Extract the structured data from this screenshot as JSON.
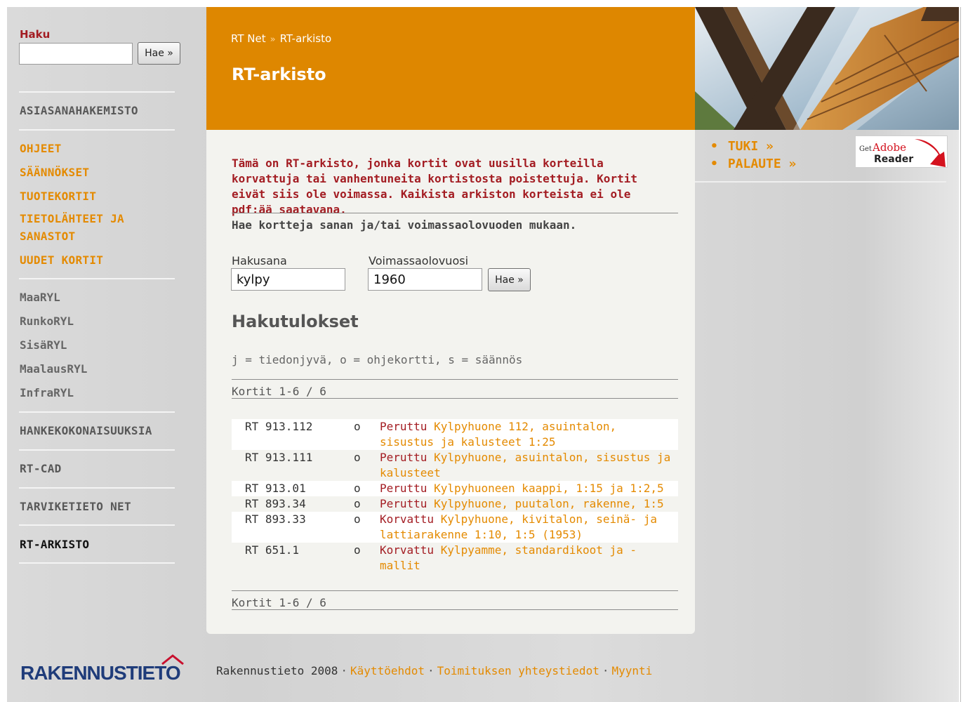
{
  "sidebar": {
    "search_label": "Haku",
    "search_button": "Hae »",
    "nav_top": "ASIASANAHAKEMISTO",
    "orange_items": [
      "OHJEET",
      "SÄÄNNÖKSET",
      "TUOTEKORTIT",
      "TIETOLÄHTEET JA",
      "SANASTOT",
      "UUDET KORTIT"
    ],
    "ryl_items": [
      "MaaRYL",
      "RunkoRYL",
      "SisäRYL",
      "MaalausRYL",
      "InfraRYL"
    ],
    "section_items": [
      "HANKEKOKONAISUUKSIA",
      "RT-CAD",
      "TARVIKETIETO NET",
      "RT-ARKISTO"
    ]
  },
  "header": {
    "breadcrumb": [
      "RT Net",
      "RT-arkisto"
    ],
    "breadcrumb_sep": "»",
    "title": "RT-arkisto"
  },
  "main": {
    "notice": "Tämä on RT-arkisto, jonka kortit ovat uusilla korteilla korvattuja tai vanhentuneita kortistosta poistettuja. Kortit eivät siis ole voimassa. Kaikista arkiston korteista ei ole pdf:ää saatavana.",
    "instructions": "Hae kortteja sanan ja/tai voimassaolovuoden mukaan.",
    "keyword_label": "Hakusana",
    "keyword_value": "kylpy",
    "year_label": "Voimassaolovuosi",
    "year_value": "1960",
    "search_button": "Hae »",
    "results_title": "Hakutulokset",
    "legend": "j = tiedonjyvä, o = ohjekortti, s = säännös",
    "count_top": "Kortit 1-6 / 6",
    "count_bottom": "Kortit 1-6 / 6",
    "results": [
      {
        "code": "RT 913.112",
        "type": "o",
        "status": "Peruttu",
        "title": "Kylpyhuone 112, asuintalon, sisustus ja kalusteet 1:25"
      },
      {
        "code": "RT 913.111",
        "type": "o",
        "status": "Peruttu",
        "title": "Kylpyhuone, asuintalon, sisustus ja kalusteet"
      },
      {
        "code": "RT 913.01",
        "type": "o",
        "status": "Peruttu",
        "title": "Kylpyhuoneen kaappi, 1:15 ja 1:2,5"
      },
      {
        "code": "RT 893.34",
        "type": "o",
        "status": "Peruttu",
        "title": "Kylpyhuone, puutalon, rakenne, 1:5"
      },
      {
        "code": "RT 893.33",
        "type": "o",
        "status": "Korvattu",
        "title": "Kylpyhuone, kivitalon, seinä- ja lattiarakenne 1:10, 1:5 (1953)"
      },
      {
        "code": "RT 651.1",
        "type": "o",
        "status": "Korvattu",
        "title": "Kylpyamme, standardikoot ja -mallit"
      }
    ]
  },
  "right": {
    "links": [
      "TUKI »",
      "PALAUTE »"
    ],
    "adobe_get": "Get",
    "adobe_brand": "Adobe",
    "adobe_product": "Reader"
  },
  "footer": {
    "logo_text": "RAKENNUSTIETO",
    "copyright": "Rakennustieto 2008",
    "links": [
      "Käyttöehdot",
      "Toimituksen yhteystiedot",
      "Myynti"
    ]
  },
  "colors": {
    "accent": "#de8700",
    "link": "#e48a00",
    "alert": "#a31c22",
    "logo": "#1f3c7a"
  }
}
